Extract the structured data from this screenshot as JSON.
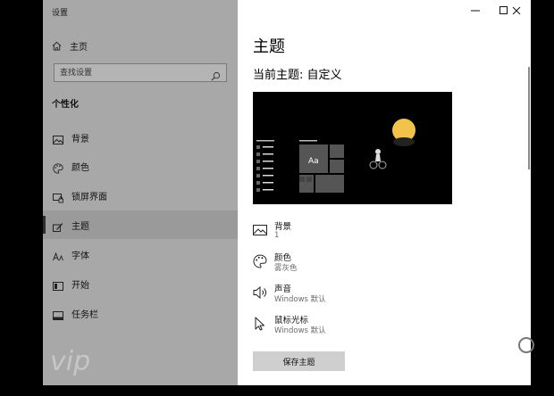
{
  "window": {
    "title": "设置"
  },
  "sidebar": {
    "home_label": "主页",
    "search_placeholder": "查找设置",
    "section_title": "个性化",
    "items": [
      {
        "label": "背景",
        "icon": "image-icon"
      },
      {
        "label": "颜色",
        "icon": "palette-icon"
      },
      {
        "label": "锁屏界面",
        "icon": "lock-screen-icon"
      },
      {
        "label": "主题",
        "icon": "theme-brush-icon",
        "active": true
      },
      {
        "label": "字体",
        "icon": "font-icon"
      },
      {
        "label": "开始",
        "icon": "start-icon"
      },
      {
        "label": "任务栏",
        "icon": "taskbar-icon"
      }
    ],
    "watermark": "vip"
  },
  "main": {
    "title": "主题",
    "current_theme": "当前主题: 自定义",
    "preview_sample": "Aa",
    "settings": [
      {
        "label": "背景",
        "value": "1",
        "icon": "image-icon"
      },
      {
        "label": "颜色",
        "value": "雾灰色",
        "icon": "palette-icon"
      },
      {
        "label": "声音",
        "value": "Windows 默认",
        "icon": "speaker-icon"
      },
      {
        "label": "鼠标光标",
        "value": "Windows 默认",
        "icon": "cursor-icon"
      }
    ],
    "save_button": "保存主题"
  },
  "colors": {
    "sidebar_bg": "#a8a8a8",
    "active_item_bg": "#9a9a9a",
    "preview_bg": "#000000",
    "preview_tiles": "#555555",
    "moon": "#f2c24b",
    "save_button_bg": "#cfcfcf"
  }
}
